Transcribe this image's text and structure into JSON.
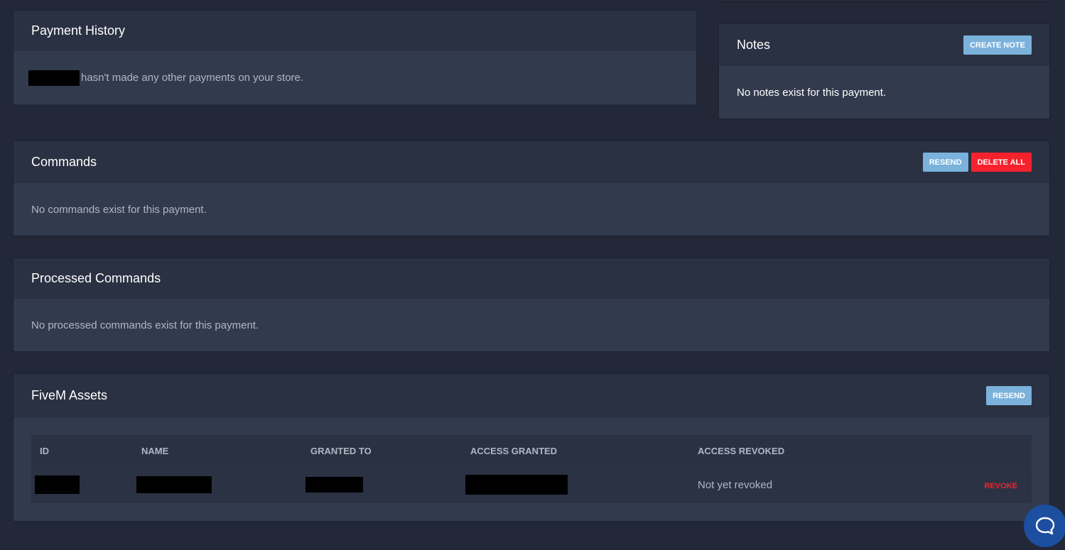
{
  "payment_history": {
    "title": "Payment History",
    "message": "hasn't made any other payments on your store."
  },
  "notes": {
    "title": "Notes",
    "create_label": "CREATE NOTE",
    "empty_message": "No notes exist for this payment."
  },
  "commands": {
    "title": "Commands",
    "resend_label": "RESEND",
    "delete_all_label": "DELETE ALL",
    "empty_message": "No commands exist for this payment."
  },
  "processed_commands": {
    "title": "Processed Commands",
    "empty_message": "No processed commands exist for this payment."
  },
  "fivem_assets": {
    "title": "FiveM Assets",
    "resend_label": "RESEND",
    "columns": [
      "ID",
      "NAME",
      "GRANTED TO",
      "ACCESS GRANTED",
      "ACCESS REVOKED"
    ],
    "rows": [
      {
        "access_revoked": "Not yet revoked",
        "action_label": "REVOKE"
      }
    ]
  },
  "colors": {
    "accent_blue": "#7ab2dc",
    "danger_red": "#f5222d",
    "chat_bubble": "#1d4fa0"
  }
}
